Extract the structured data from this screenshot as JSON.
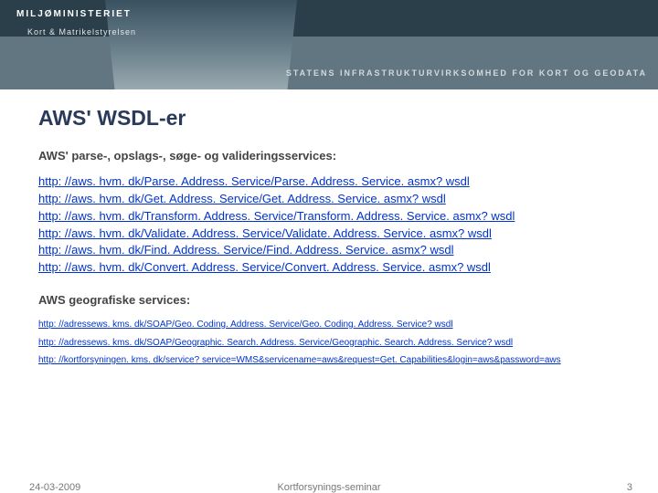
{
  "banner": {
    "ministry": "MILJØMINISTERIET",
    "agency": "Kort & Matrikelstyrelsen",
    "tagline": "STATENS INFRASTRUKTURVIRKSOMHED FOR KORT OG GEODATA"
  },
  "title": "AWS' WSDL-er",
  "section1_heading": "AWS' parse-, opslags-, søge- og valideringsservices:",
  "links1": [
    "http: //aws. hvm. dk/Parse. Address. Service/Parse. Address. Service. asmx? wsdl",
    "http: //aws. hvm. dk/Get. Address. Service/Get. Address. Service. asmx? wsdl",
    "http: //aws. hvm. dk/Transform. Address. Service/Transform. Address. Service. asmx? wsdl",
    "http: //aws. hvm. dk/Validate. Address. Service/Validate. Address. Service. asmx? wsdl",
    "http: //aws. hvm. dk/Find. Address. Service/Find. Address. Service. asmx? wsdl",
    "http: //aws. hvm. dk/Convert. Address. Service/Convert. Address. Service. asmx? wsdl"
  ],
  "section2_heading": "AWS geografiske services:",
  "links2": [
    "http: //adressews. kms. dk/SOAP/Geo. Coding. Address. Service/Geo. Coding. Address. Service? wsdl",
    "http: //adressews. kms. dk/SOAP/Geographic. Search. Address. Service/Geographic. Search. Address. Service? wsdl",
    "http: //kortforsyningen. kms. dk/service? service=WMS&servicename=aws&request=Get. Capabilities&login=aws&password=aws"
  ],
  "footer": {
    "date": "24-03-2009",
    "center": "Kortforsynings-seminar",
    "page": "3"
  }
}
